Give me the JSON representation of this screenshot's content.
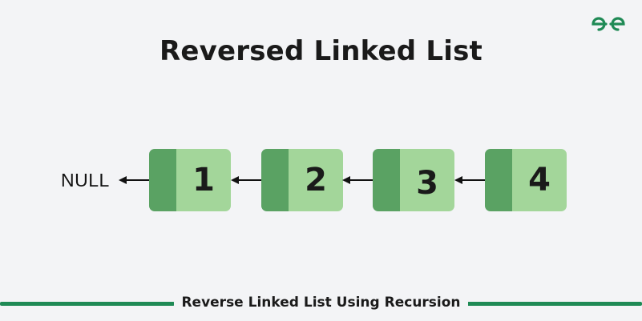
{
  "title": "Reversed Linked List",
  "logo": {
    "name": "gfg-logo",
    "color": "#1f8a55"
  },
  "null_label": "NULL",
  "nodes": [
    {
      "value": "1"
    },
    {
      "value": "2"
    },
    {
      "value": "3"
    },
    {
      "value": "4"
    }
  ],
  "colors": {
    "pointer_cell": "#5aa263",
    "value_cell": "#a3d69a",
    "accent": "#1f8a55"
  },
  "footer": {
    "caption": "Reverse Linked List Using Recursion"
  }
}
